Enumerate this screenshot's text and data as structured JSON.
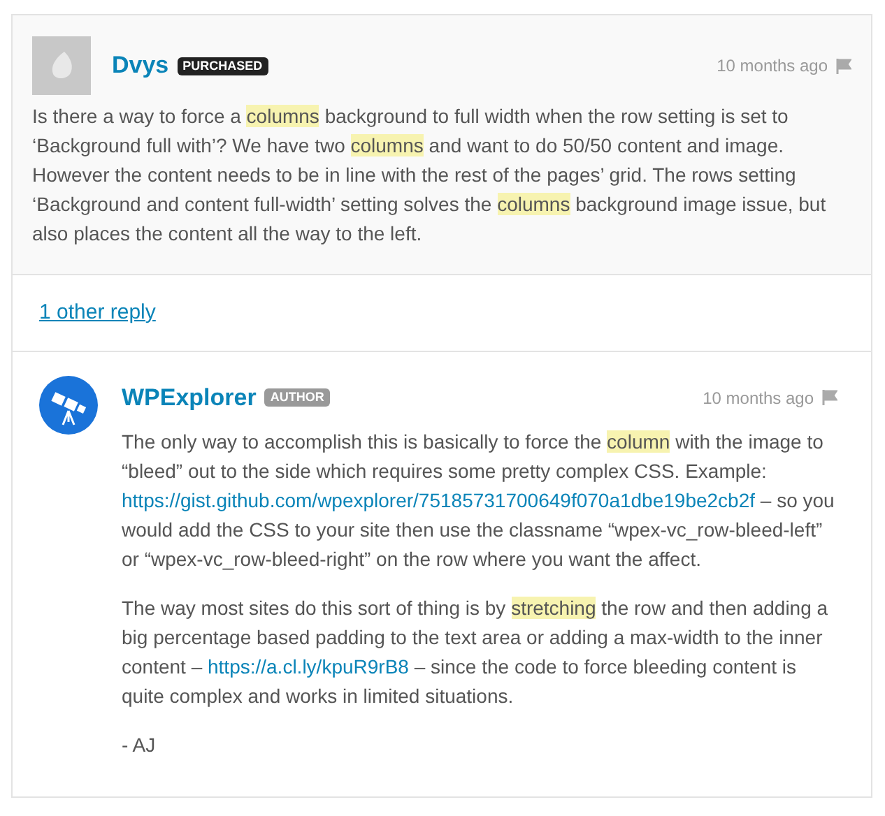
{
  "comments": [
    {
      "author": "Dvys",
      "badge": {
        "label": "PURCHASED",
        "kind": "buyer"
      },
      "avatar": {
        "kind": "placeholder"
      },
      "time": "10 months ago",
      "paragraphs": [
        [
          {
            "kind": "text",
            "text": "Is there a way to force a "
          },
          {
            "kind": "highlight",
            "text": "columns"
          },
          {
            "kind": "text",
            "text": " background to full width when the row setting is set to ‘Background full with’? We have two "
          },
          {
            "kind": "highlight",
            "text": "columns"
          },
          {
            "kind": "text",
            "text": " and want to do 50/50 content and image. However the content needs to be in line with the rest of the pages’ grid. The rows setting ‘Background and content full-width’ setting solves the "
          },
          {
            "kind": "highlight",
            "text": "columns"
          },
          {
            "kind": "text",
            "text": " background image issue, but also places the content all the way to the left."
          }
        ]
      ]
    }
  ],
  "replies_link": "1 other reply",
  "replies": [
    {
      "author": "WPExplorer",
      "badge": {
        "label": "AUTHOR",
        "kind": "author"
      },
      "avatar": {
        "kind": "logo"
      },
      "time": "10 months ago",
      "paragraphs": [
        [
          {
            "kind": "text",
            "text": "The only way to accomplish this is basically to force the "
          },
          {
            "kind": "highlight",
            "text": "column"
          },
          {
            "kind": "text",
            "text": " with the image to “bleed” out to the side which requires some pretty complex CSS. Example: "
          },
          {
            "kind": "link",
            "text": "https://gist.github.com/wpexplorer/75185731700649f070a1dbe19be2cb2f"
          },
          {
            "kind": "text",
            "text": " – so you would add the CSS to your site then use the classname “wpex-vc_row-bleed-left” or “wpex-vc_row-bleed-right” on the row where you want the affect."
          }
        ],
        [
          {
            "kind": "text",
            "text": "The way most sites do this sort of thing is by "
          },
          {
            "kind": "highlight",
            "text": "stretching"
          },
          {
            "kind": "text",
            "text": " the row and then adding a big percentage based padding to the text area or adding a max-width to the inner content – "
          },
          {
            "kind": "link",
            "text": "https://a.cl.ly/kpuR9rB8"
          },
          {
            "kind": "text",
            "text": " – since the code to force bleeding content is quite complex and works in limited situations."
          }
        ],
        [
          {
            "kind": "text",
            "text": "- AJ"
          }
        ]
      ]
    }
  ]
}
